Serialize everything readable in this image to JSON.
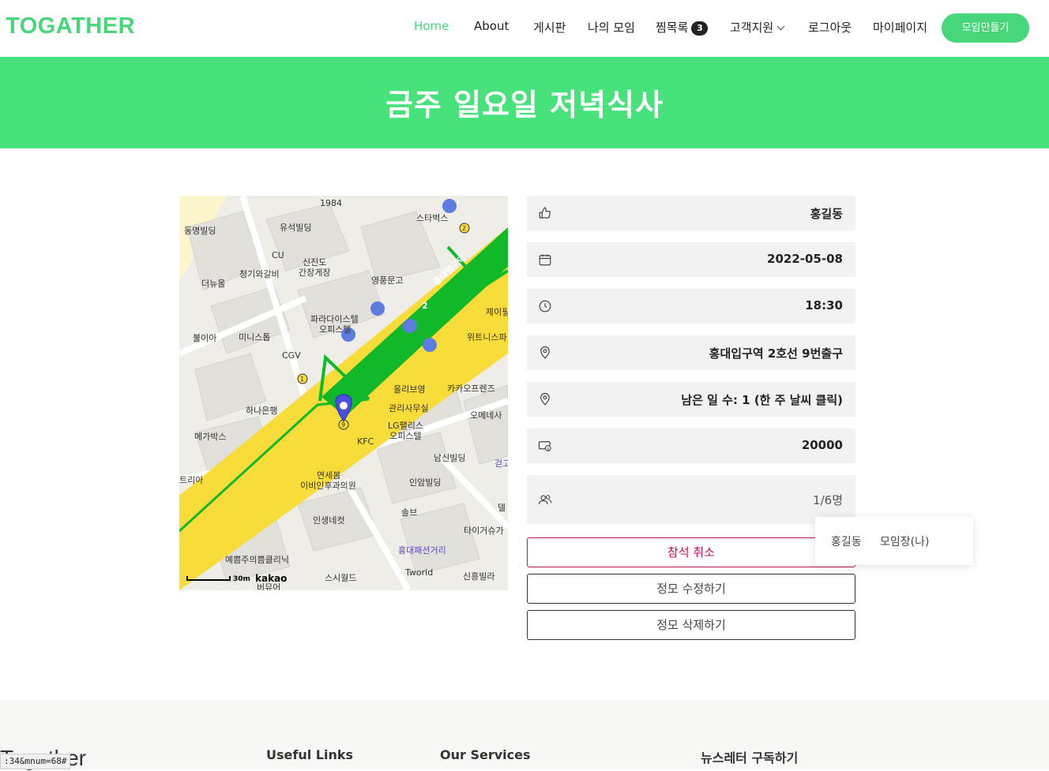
{
  "brand": "TOGATHER",
  "nav": {
    "home": "Home",
    "about": "About",
    "board": "게시판",
    "my_meetings": "나의 모임",
    "wishlist": "찜목록",
    "wishlist_count": "3",
    "support": "고객지원",
    "logout": "로그아웃",
    "mypage": "마이페이지",
    "create": "모임만들기"
  },
  "hero_title": "금주 일요일 저녁식사",
  "map": {
    "scale": "30m",
    "provider": "kakao",
    "labels": {
      "l1984": "1984",
      "starbucks": "스타벅스",
      "dongmyeong": "동명빌딩",
      "yuseok": "유석빌딩",
      "cu": "CU",
      "cheonggiwa": "청기와갈비",
      "sinjindo": "신진도",
      "ganjang": "간장게장",
      "youngpung": "영풍문고",
      "station": "홍대입구역",
      "line2": "2",
      "deonyuol": "더뉴올",
      "paradise1": "파라다이스텔",
      "paradise2": "오피스텔",
      "jeipil": "제이필",
      "bulia": "불이아",
      "miniseutop": "미니스톱",
      "cgv": "CGV",
      "witrinis": "위트니스파",
      "oliveyoung": "올리브영",
      "kakaofriends": "카카오프렌즈",
      "hana": "하나은행",
      "office_mgmt": "관리사무실",
      "omonesa": "오메네사",
      "megabox": "메가박스",
      "lgpalace1": "LG팰리스",
      "lgpalace2": "오피스텔",
      "kfc": "KFC",
      "namsin": "남신빌딩",
      "georigo": "걷고",
      "eria": "트리아",
      "yeonsebom1": "연세봄",
      "yeonsebom2": "이비인후과의원",
      "inam": "인암빌딩",
      "del": "델",
      "insaeng": "인생네컷",
      "sol": "솔브",
      "taigeo": "타이거슈가",
      "fashion": "홍대패션거리",
      "yeppeun": "예쁨주의쁨클리닉",
      "siworld": "스시월드",
      "tworld": "Tworld",
      "sinheung": "신흥빌라",
      "beoyu": "버뮤어",
      "hongik_road": "홍익로",
      "yanghwa_road": "양화로",
      "exit1": "1",
      "exit2": "2",
      "exit9": "9"
    }
  },
  "info": {
    "host": "홍길동",
    "date": "2022-05-08",
    "time": "18:30",
    "location": "홍대입구역 2호선 9번출구",
    "weather": "남은 일 수: 1 (한 주 날씨 클릭)",
    "price": "20000",
    "members": "1/6명"
  },
  "buttons": {
    "cancel": "참석 취소",
    "edit": "정모 수정하기",
    "delete": "정모 삭제하기"
  },
  "popup": {
    "name": "홍길동",
    "role": "모임장(나)"
  },
  "footer": {
    "brand": "Togather",
    "useful_links": "Useful Links",
    "our_services": "Our Services",
    "newsletter": "뉴스레터 구독하기"
  },
  "status_url": ":34&mnum=68#",
  "colors": {
    "accent": "#47d77a",
    "hero": "#47e27c",
    "cancel": "#c0174a",
    "road_yellow": "#f7dc3a",
    "subway_green": "#11b92a"
  }
}
